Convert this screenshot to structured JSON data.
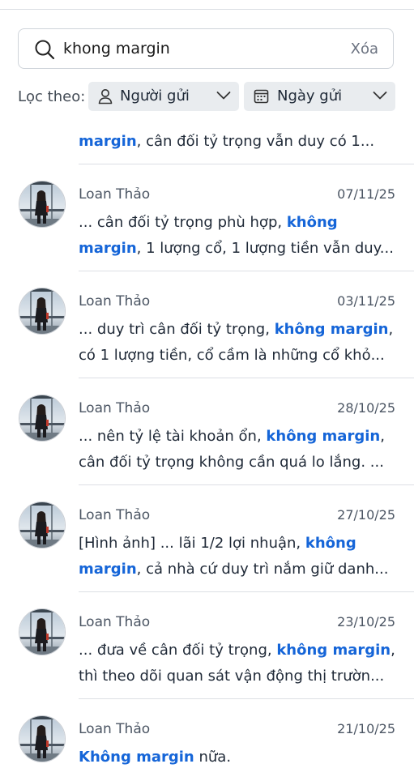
{
  "search": {
    "query": "khong margin",
    "clear_label": "Xóa"
  },
  "filters": {
    "label": "Lọc theo:",
    "sender_label": "Người gửi",
    "date_label": "Ngày gửi"
  },
  "partial_result": {
    "lines": [
      [
        {
          "t": "margin",
          "h": true
        },
        {
          "t": ", cân đối tỷ trọng vẫn duy có 1...",
          "h": false
        }
      ]
    ]
  },
  "results": [
    {
      "sender": "Loan Thảo",
      "date": "07/11/25",
      "lines": [
        [
          {
            "t": "... cân đối tỷ trọng phù hợp, ",
            "h": false
          },
          {
            "t": "không",
            "h": true
          }
        ],
        [
          {
            "t": "margin",
            "h": true
          },
          {
            "t": ", 1 lượng cổ, 1 lượng tiền vẫn duy...",
            "h": false
          }
        ]
      ]
    },
    {
      "sender": "Loan Thảo",
      "date": "03/11/25",
      "lines": [
        [
          {
            "t": "... duy trì cân đối tỷ trọng, ",
            "h": false
          },
          {
            "t": "không margin",
            "h": true
          },
          {
            "t": ",",
            "h": false
          }
        ],
        [
          {
            "t": "có 1 lượng tiền, cổ cầm là những cổ khỏ...",
            "h": false
          }
        ]
      ]
    },
    {
      "sender": "Loan Thảo",
      "date": "28/10/25",
      "lines": [
        [
          {
            "t": "... nên tỷ lệ tài khoản ổn, ",
            "h": false
          },
          {
            "t": "không margin",
            "h": true
          },
          {
            "t": ",",
            "h": false
          }
        ],
        [
          {
            "t": "cân đối tỷ trọng không cần quá lo lắng. ...",
            "h": false
          }
        ]
      ]
    },
    {
      "sender": "Loan Thảo",
      "date": "27/10/25",
      "lines": [
        [
          {
            "t": "[Hình ảnh] ... lãi 1/2 lợi nhuận, ",
            "h": false
          },
          {
            "t": "không",
            "h": true
          }
        ],
        [
          {
            "t": "margin",
            "h": true
          },
          {
            "t": ", cả nhà cứ duy trì nắm giữ danh...",
            "h": false
          }
        ]
      ]
    },
    {
      "sender": "Loan Thảo",
      "date": "23/10/25",
      "lines": [
        [
          {
            "t": "... đưa về cân đối tỷ trọng, ",
            "h": false
          },
          {
            "t": "không margin",
            "h": true
          },
          {
            "t": ",",
            "h": false
          }
        ],
        [
          {
            "t": "thì theo dõi quan sát vận động thị trườn...",
            "h": false
          }
        ]
      ]
    },
    {
      "sender": "Loan Thảo",
      "date": "21/10/25",
      "lines": [
        [
          {
            "t": "Không margin",
            "h": true
          },
          {
            "t": " nữa.",
            "h": false
          }
        ]
      ]
    }
  ],
  "colors": {
    "highlight": "#1565d8",
    "chip_bg": "#e9ecef"
  }
}
